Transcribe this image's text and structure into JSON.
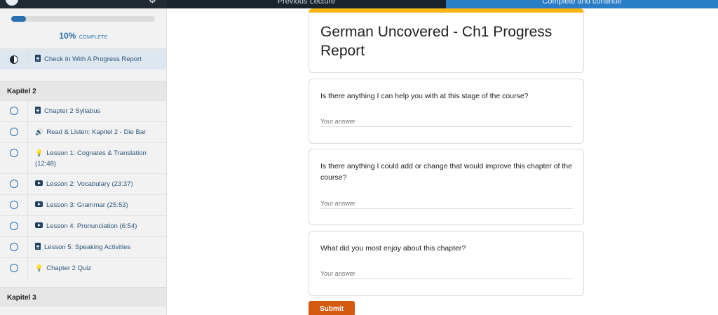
{
  "topbar": {
    "previous_label": "Previous Lecture",
    "next_label": "Complete and continue"
  },
  "sidebar": {
    "progress_percent": 10,
    "progress_value": "10%",
    "progress_caption": "COMPLETE",
    "current_item": "Check In With A Progress Report",
    "sections": [
      {
        "title": "Kapitel 2",
        "items": [
          {
            "icon": "document-icon",
            "label": "Chapter 2 Syllabus"
          },
          {
            "icon": "audio-icon",
            "label": "Read & Listen: Kapitel 2 - Die Bar"
          },
          {
            "icon": "lightbulb-icon",
            "label": "Lesson 1: Cognates & Translation (12:48)"
          },
          {
            "icon": "video-icon",
            "label": "Lesson 2: Vocabulary (23:37)"
          },
          {
            "icon": "video-icon",
            "label": "Lesson 3: Grammar (25:53)"
          },
          {
            "icon": "video-icon",
            "label": "Lesson 4: Pronunciation (6:54)"
          },
          {
            "icon": "document-icon",
            "label": "Lesson 5: Speaking Activities"
          },
          {
            "icon": "lightbulb-icon",
            "label": "Chapter 2 Quiz"
          }
        ]
      },
      {
        "title": "Kapitel 3",
        "items": []
      }
    ]
  },
  "form": {
    "title": "German Uncovered - Ch1 Progress Report",
    "accent_color": "#f9b617",
    "questions": [
      {
        "text": "Is there anything I can help you with at this stage of the course?",
        "placeholder": "Your answer"
      },
      {
        "text": "Is there anything I could add or change that would improve this chapter of the course?",
        "placeholder": "Your answer"
      },
      {
        "text": "What did you most enjoy about this chapter?",
        "placeholder": "Your answer"
      }
    ],
    "submit_label": "Submit",
    "submit_color": "#d35a0f"
  }
}
